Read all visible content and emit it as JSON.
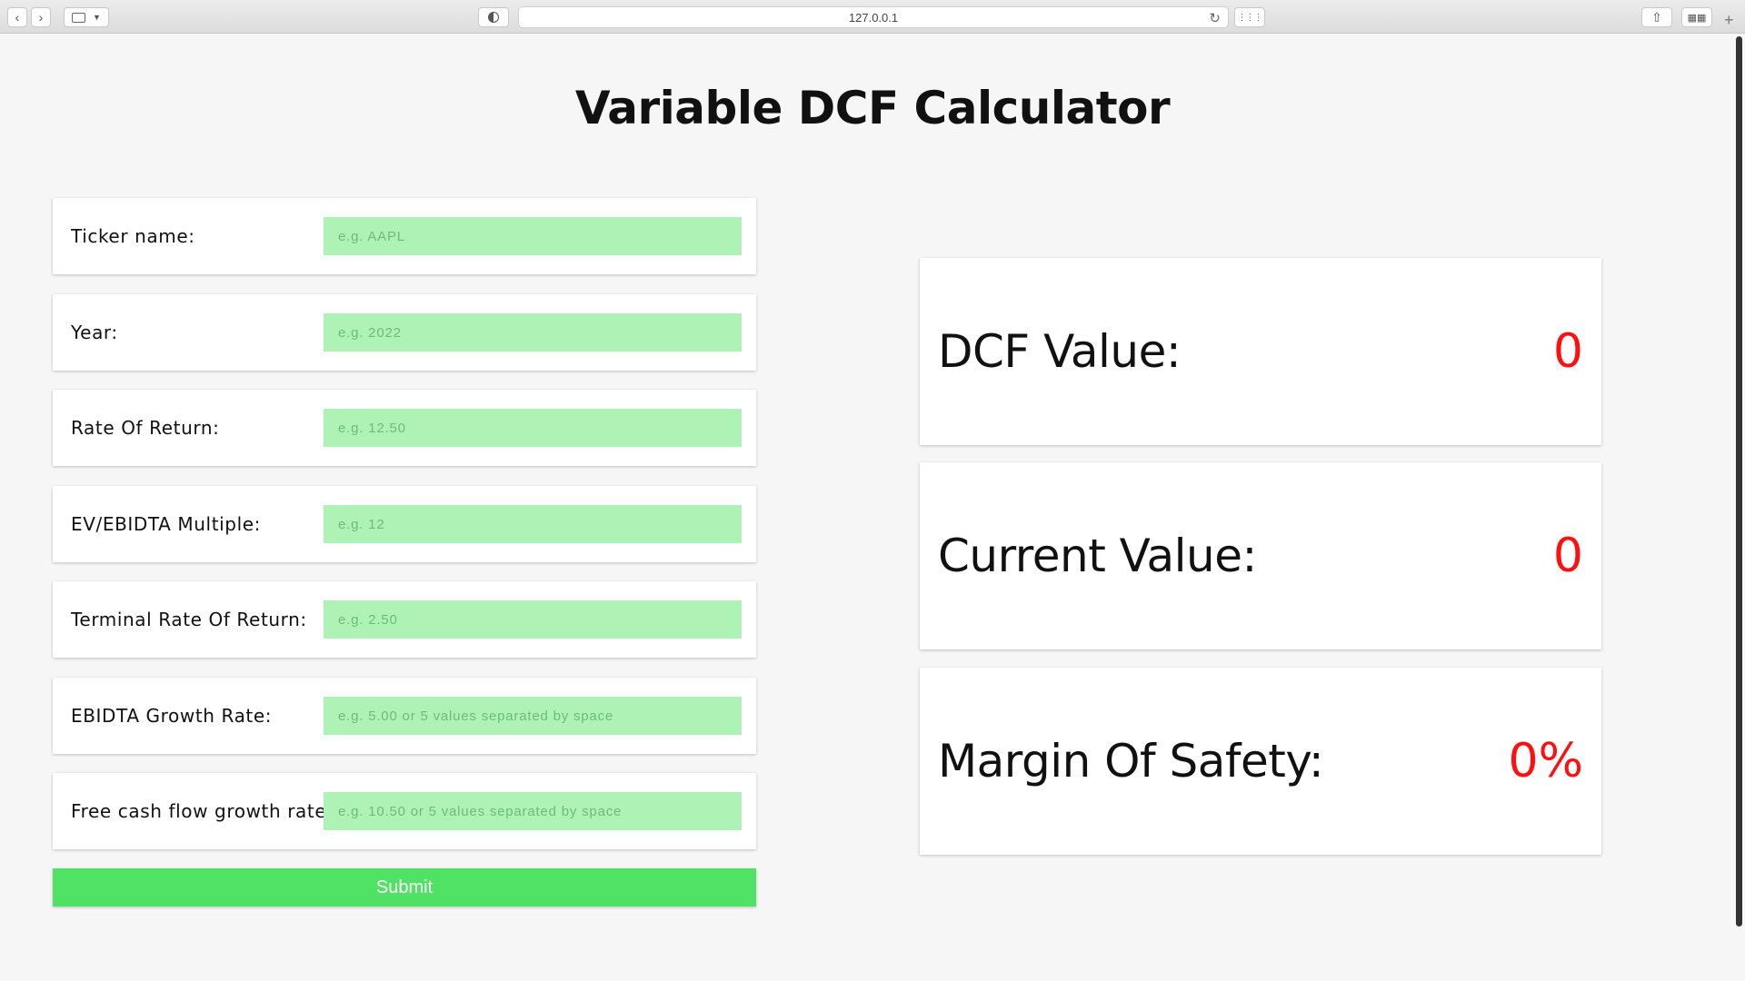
{
  "browser": {
    "url": "127.0.0.1"
  },
  "page": {
    "title": "Variable DCF Calculator"
  },
  "form": {
    "fields": [
      {
        "label": "Ticker name:",
        "placeholder": "e.g. AAPL"
      },
      {
        "label": "Year:",
        "placeholder": "e.g. 2022"
      },
      {
        "label": "Rate Of Return:",
        "placeholder": "e.g. 12.50"
      },
      {
        "label": "EV/EBIDTA Multiple:",
        "placeholder": "e.g. 12"
      },
      {
        "label": "Terminal Rate Of Return:",
        "placeholder": "e.g. 2.50"
      },
      {
        "label": "EBIDTA Growth Rate:",
        "placeholder": "e.g. 5.00 or 5 values separated by space"
      },
      {
        "label": "Free cash flow growth rate:",
        "placeholder": "e.g. 10.50 or 5 values separated by space"
      }
    ],
    "submit_label": "Submit"
  },
  "results": [
    {
      "label": "DCF Value:",
      "value": "0"
    },
    {
      "label": "Current Value:",
      "value": "0"
    },
    {
      "label": "Margin Of Safety:",
      "value": "0%"
    }
  ],
  "colors": {
    "input_bg": "#aef2b6",
    "submit_bg": "#50e265",
    "value_color": "#ff1010"
  }
}
